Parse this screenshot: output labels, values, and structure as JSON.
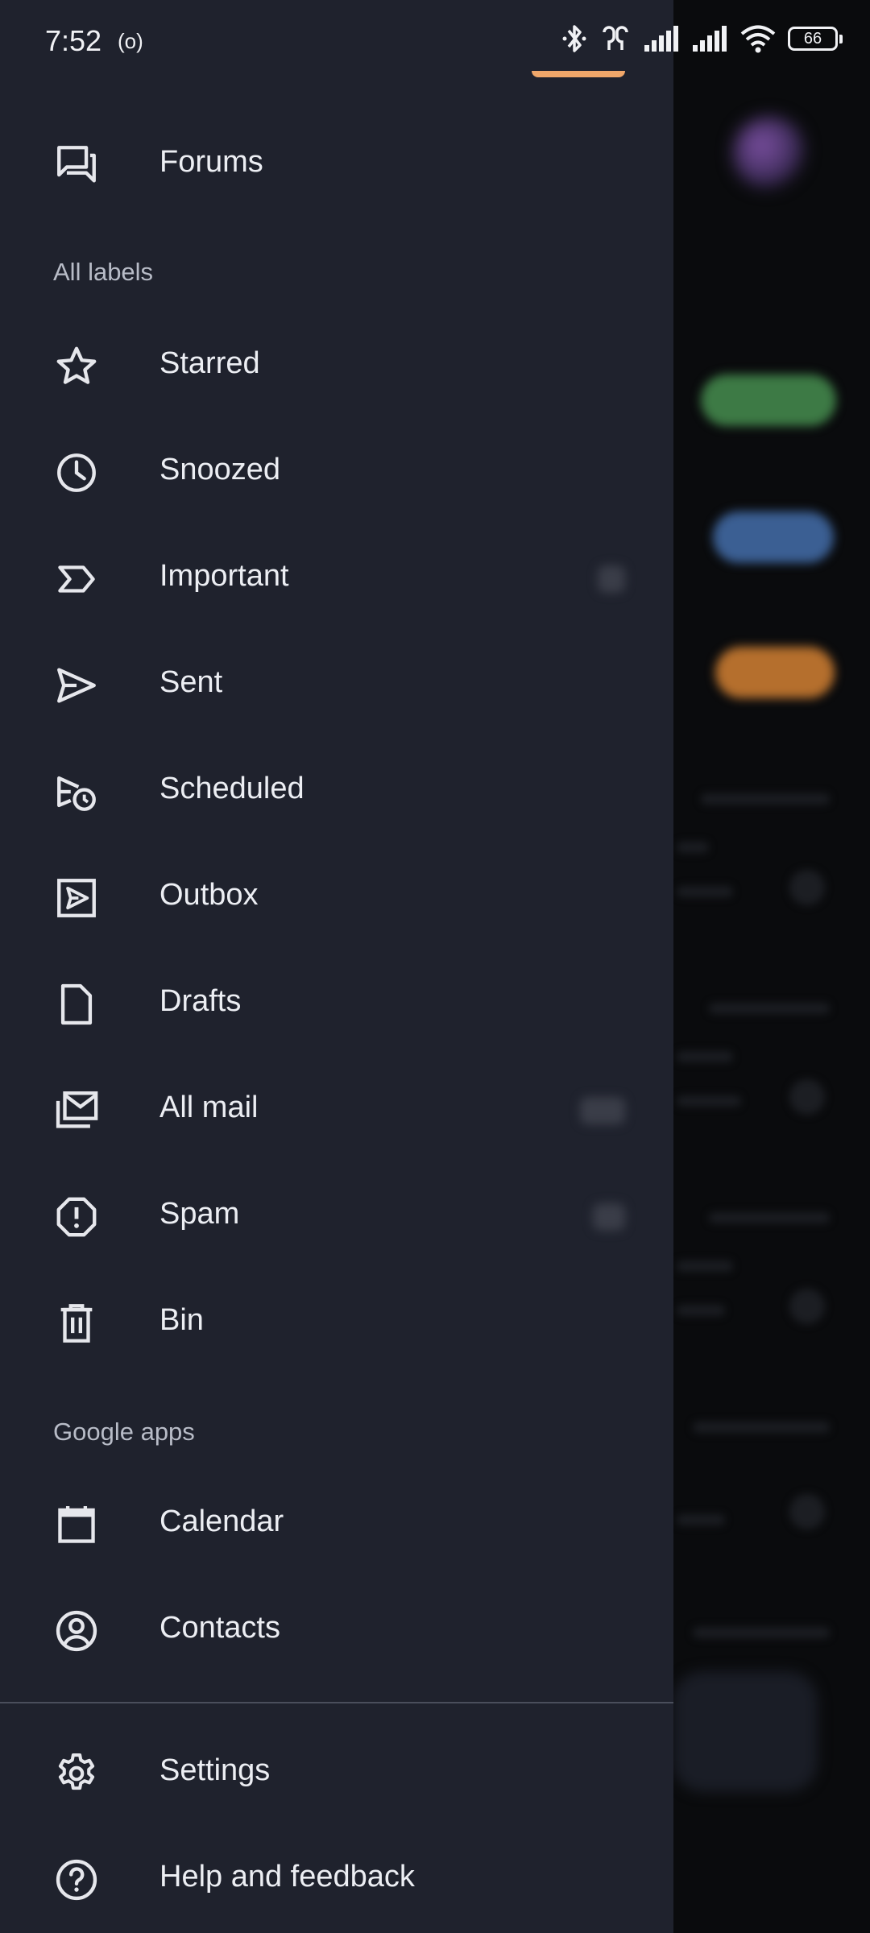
{
  "status_bar": {
    "time": "7:52",
    "battery": "66"
  },
  "drawer": {
    "items_top": [
      {
        "label": "Forums",
        "icon": "forums-icon"
      }
    ],
    "section_all_labels": "All labels",
    "labels": [
      {
        "label": "Starred",
        "icon": "star-icon"
      },
      {
        "label": "Snoozed",
        "icon": "clock-icon"
      },
      {
        "label": "Important",
        "icon": "important-icon"
      },
      {
        "label": "Sent",
        "icon": "send-icon"
      },
      {
        "label": "Scheduled",
        "icon": "scheduled-icon"
      },
      {
        "label": "Outbox",
        "icon": "outbox-icon"
      },
      {
        "label": "Drafts",
        "icon": "draft-icon"
      },
      {
        "label": "All mail",
        "icon": "all-mail-icon"
      },
      {
        "label": "Spam",
        "icon": "spam-icon"
      },
      {
        "label": "Bin",
        "icon": "bin-icon"
      }
    ],
    "section_google_apps": "Google apps",
    "apps": [
      {
        "label": "Calendar",
        "icon": "calendar-icon"
      },
      {
        "label": "Contacts",
        "icon": "contacts-icon"
      }
    ],
    "bottom": [
      {
        "label": "Settings",
        "icon": "gear-icon"
      },
      {
        "label": "Help and feedback",
        "icon": "help-icon"
      }
    ]
  },
  "colors": {
    "drawer_bg": "#1f222d",
    "accent": "#f0a76a",
    "text": "#eceef3",
    "section_text": "#b8bcc7"
  }
}
